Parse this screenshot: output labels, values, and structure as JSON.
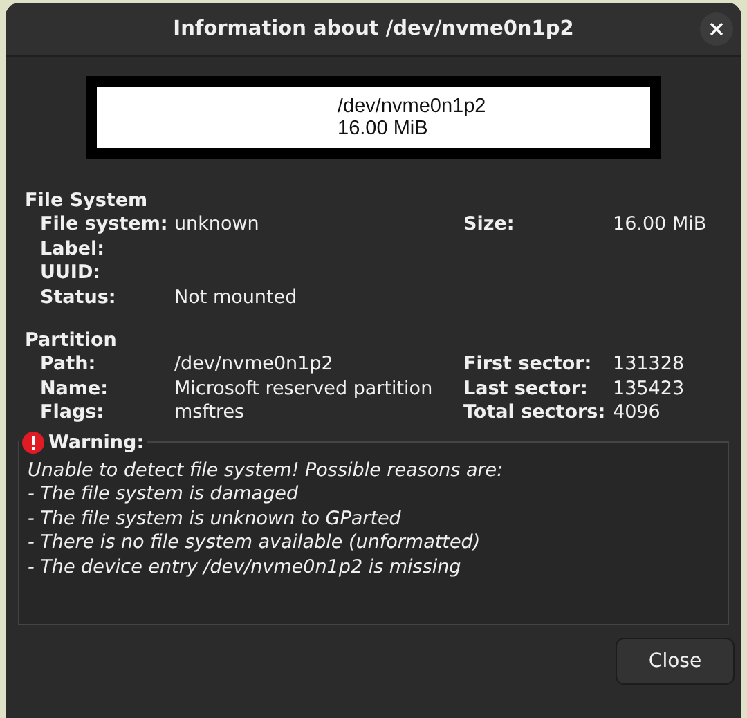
{
  "window": {
    "title": "Information about /dev/nvme0n1p2"
  },
  "partition_graphic": {
    "path": "/dev/nvme0n1p2",
    "size": "16.00 MiB"
  },
  "sections": [
    {
      "title": "File System",
      "fields": [
        {
          "label": "File system:",
          "value": "unknown"
        },
        {
          "label": "Label:"
        },
        {
          "label": "UUID:"
        },
        {
          "label": "Status:",
          "value": "Not mounted"
        }
      ],
      "side_fields": [
        {
          "label": "Size:",
          "value": "16.00 MiB"
        }
      ]
    },
    {
      "title": "Partition",
      "fields": [
        {
          "label": "Path:",
          "value": "/dev/nvme0n1p2"
        },
        {
          "label": "Name:",
          "value": "Microsoft reserved partition"
        },
        {
          "label": "Flags:",
          "value": "msftres"
        }
      ],
      "side_fields": [
        {
          "label": "First sector:",
          "value": "131328"
        },
        {
          "label": "Last sector:",
          "value": "135423"
        },
        {
          "label": "Total sectors:",
          "value": "4096"
        }
      ]
    }
  ],
  "warning": {
    "title": "Warning:",
    "lines": [
      "Unable to detect file system! Possible reasons are:",
      "- The file system is damaged",
      "- The file system is unknown to GParted",
      "- There is no file system available (unformatted)",
      "- The device entry /dev/nvme0n1p2 is missing"
    ]
  },
  "buttons": [
    "Close"
  ]
}
